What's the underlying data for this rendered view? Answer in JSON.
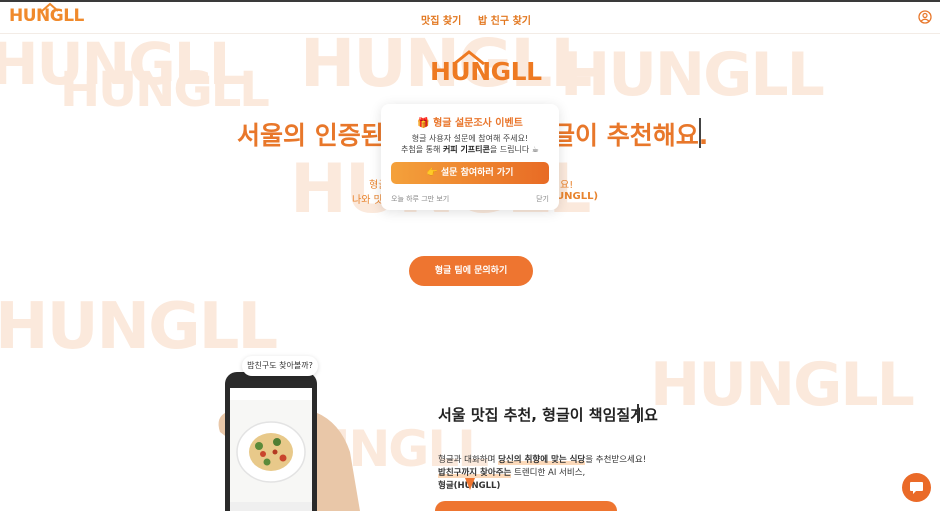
{
  "nav": {
    "logo": "HUNGLL",
    "links": [
      "맛집 찾기",
      "밥 친구 찾기"
    ],
    "user_icon": "user-circle-icon"
  },
  "watermark": "HUNGLL",
  "hero": {
    "logo": "HUNGLL",
    "title_left": "서울의 인증된",
    "title_right": "글이 추천해요.",
    "sub_line1_left": "형글",
    "sub_line1_right": "요!",
    "sub_line2_left": "나와 맛는",
    "sub_line2_right": "UNGLL)"
  },
  "popup": {
    "icon": "gift-icon",
    "title": "형글 설문조사 이벤트",
    "line1": "형글 사용자 설문에 참여해 주세요!",
    "line2_pre": "추첨을 통해 ",
    "line2_bold": "커피 기프티콘",
    "line2_post": "을 드립니다 ☕",
    "button": "👉 설문 참여하러 가기",
    "dismiss_today": "오늘 하루 그만 보기",
    "close": "닫기"
  },
  "cta": {
    "label": "형글 팀에 문의하기"
  },
  "section2": {
    "bubble": "밥친구도 찾아볼까?",
    "title": "서울 맛집 추천, 형글이 책임질게요",
    "line1_pre": "형글과 대화하며 ",
    "line1_hl": "당신의 취향에 맞는 식당",
    "line1_post": "을 추천받으세요!",
    "line2_hl": "밥친구까지 찾아주는",
    "line2_post": " 트렌디한 AI 서비스,",
    "line3": "형글(HUNGLL)"
  },
  "colors": {
    "brand": "#ee7530",
    "watermark": "#fbe9dc"
  }
}
